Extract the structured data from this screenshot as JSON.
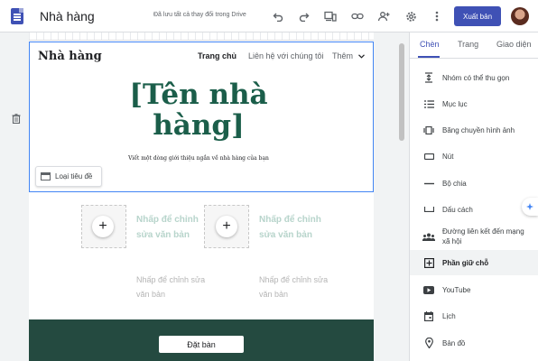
{
  "app": {
    "title": "Nhà hàng",
    "save_status": "Đã lưu tất cả thay đổi trong Drive",
    "publish_label": "Xuất bản"
  },
  "toolbar": {
    "icons": [
      "undo-icon",
      "redo-icon",
      "preview-devices-icon",
      "insert-link-icon",
      "share-icon",
      "settings-icon",
      "more-vert-icon"
    ]
  },
  "site": {
    "name": "Nhà hàng",
    "nav": [
      "Trang chủ",
      "Liên hệ với chúng tôi",
      "Thêm"
    ],
    "hero_title": "[Tên nhà hàng]",
    "hero_subtitle": "Viết một dòng giới thiệu ngắn về nhà hàng của bạn",
    "header_type_label": "Loại tiêu đề",
    "columns": [
      {
        "big_text": "Nhấp để chỉnh sửa văn bản",
        "small_text": "Nhấp để chỉnh sửa văn bản"
      },
      {
        "big_text": "Nhấp để chỉnh sửa văn bản",
        "small_text": "Nhấp để chỉnh sửa văn bản"
      }
    ],
    "reserve_label": "Đặt bàn"
  },
  "panel": {
    "tabs": [
      "Chèn",
      "Trang",
      "Giao diện"
    ],
    "active_tab": "Chèn",
    "items": [
      {
        "label": "Nhóm có thể thu gọn",
        "icon": "collapsible-group-icon"
      },
      {
        "label": "Mục lục",
        "icon": "table-of-contents-icon"
      },
      {
        "label": "Băng chuyền hình ảnh",
        "icon": "image-carousel-icon"
      },
      {
        "label": "Nút",
        "icon": "button-icon"
      },
      {
        "label": "Bộ chia",
        "icon": "divider-icon"
      },
      {
        "label": "Dấu cách",
        "icon": "spacer-icon"
      },
      {
        "label": "Đường liên kết đến mạng xã hội",
        "icon": "social-links-icon"
      },
      {
        "label": "Phần giữ chỗ",
        "icon": "placeholder-icon"
      },
      {
        "label": "YouTube",
        "icon": "youtube-icon"
      },
      {
        "label": "Lịch",
        "icon": "calendar-icon"
      },
      {
        "label": "Bản đồ",
        "icon": "map-icon"
      }
    ],
    "selected_item": "Phần giữ chỗ"
  },
  "colors": {
    "accent": "#3f51b5",
    "hero_text": "#1b5e4a",
    "footer_band": "#244a40",
    "selection": "#4285f4"
  }
}
